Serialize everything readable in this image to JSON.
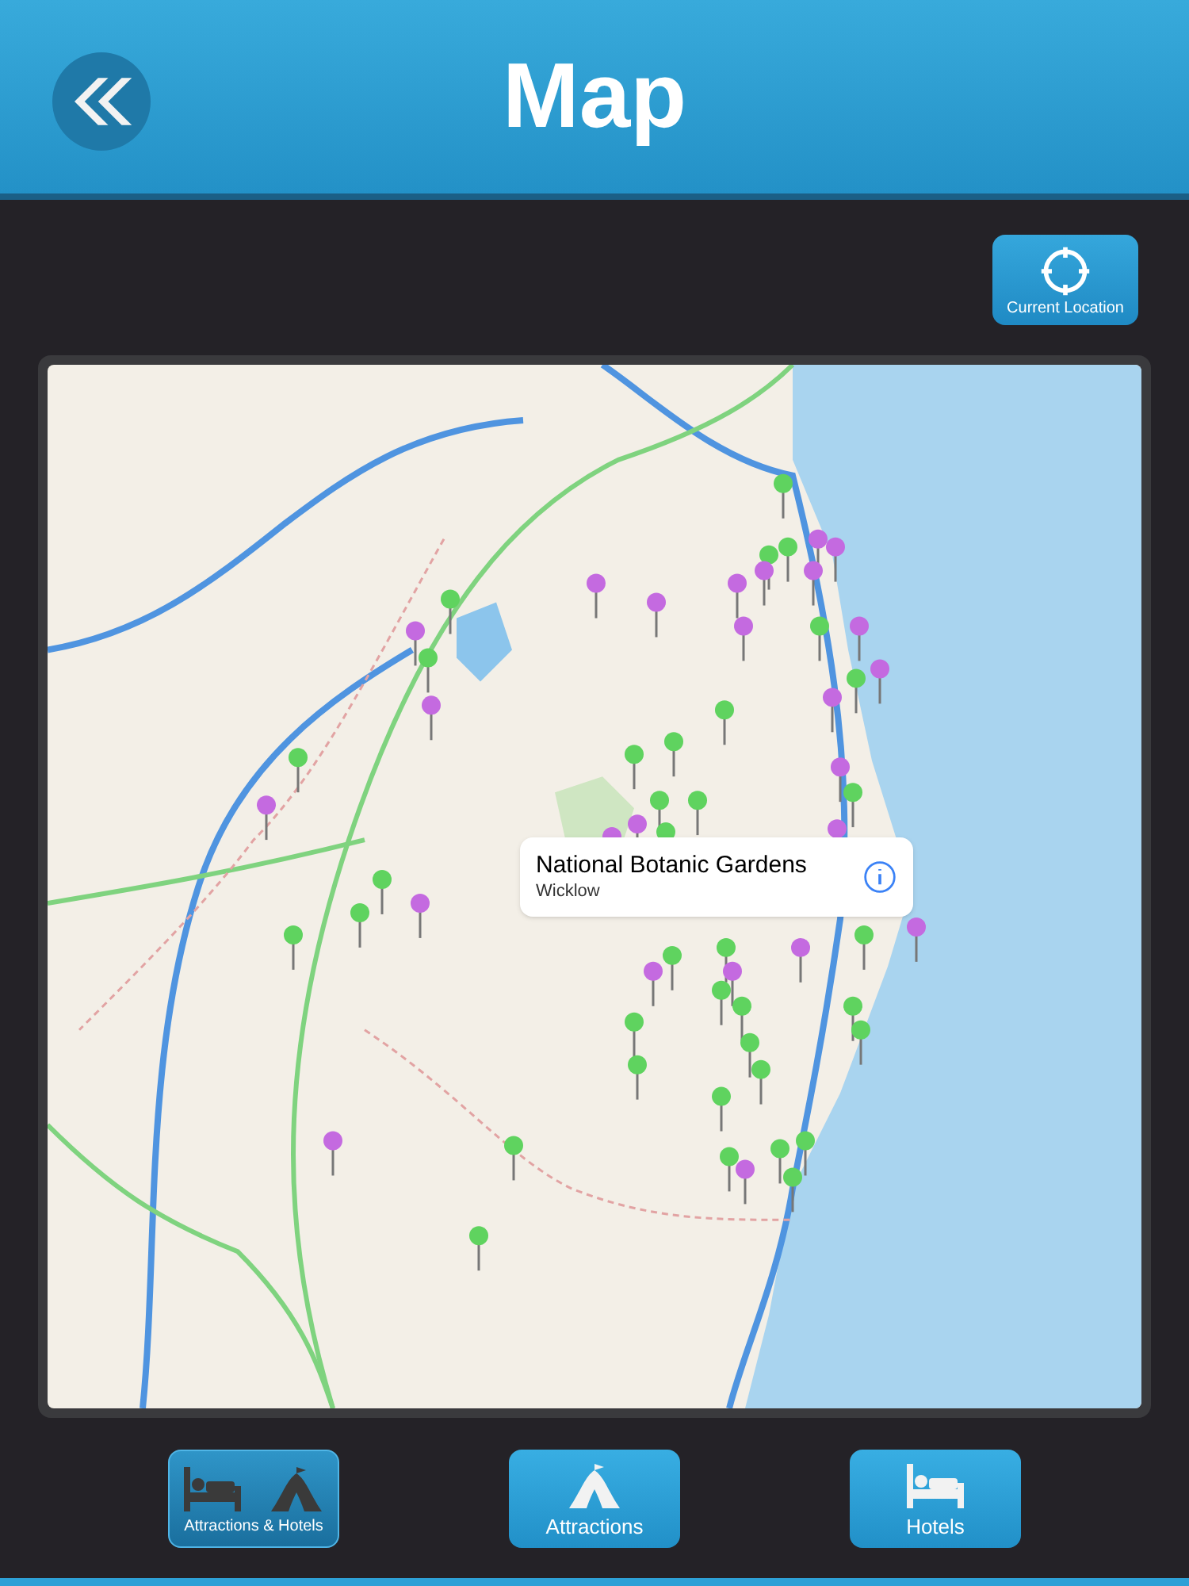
{
  "header": {
    "title": "Map"
  },
  "current_location": {
    "label": "Current Location"
  },
  "callout": {
    "title": "National Botanic Gardens",
    "subtitle": "Wicklow"
  },
  "filters": [
    {
      "kind": "both",
      "label": "Attractions & Hotels",
      "selected": true
    },
    {
      "kind": "attractions",
      "label": "Attractions",
      "selected": false
    },
    {
      "kind": "hotels",
      "label": "Hotels",
      "selected": false
    }
  ]
}
